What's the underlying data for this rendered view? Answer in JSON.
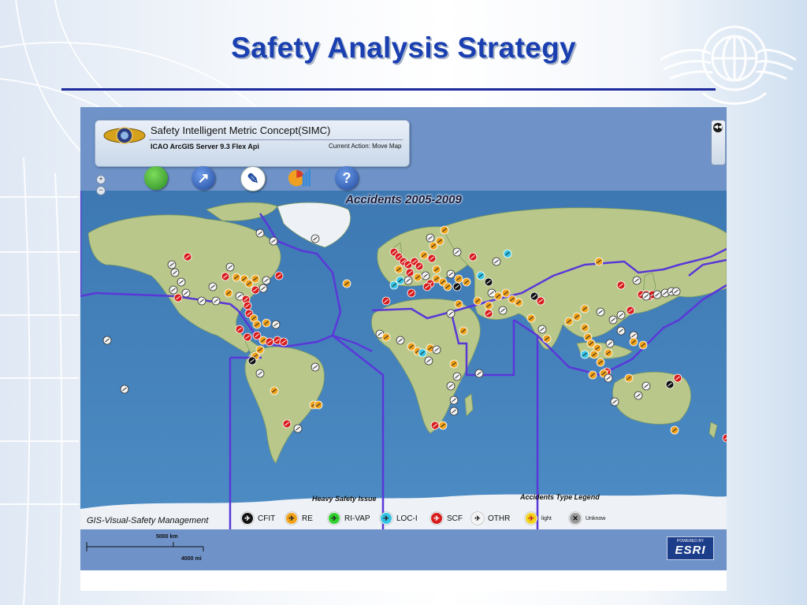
{
  "slide": {
    "title": "Safety Analysis Strategy"
  },
  "app": {
    "title": "Safety Intelligent Metric Concept(SIMC)",
    "subtitle": "ICAO ArcGIS Server 9.3 Flex Api",
    "current_action": "Current Action: Move Map",
    "zoom_in": "+",
    "zoom_out": "−"
  },
  "toolbar": {
    "tools": [
      {
        "icon": "globe-icon",
        "glyph": "",
        "color": "#3ea33a"
      },
      {
        "icon": "compass-icon",
        "glyph": "↗",
        "color": "#2c5cb8"
      },
      {
        "icon": "tools-icon",
        "glyph": "✎",
        "color": "#ffffff"
      },
      {
        "icon": "chart-icon",
        "glyph": "",
        "color": "#e8a020"
      },
      {
        "icon": "help-icon",
        "glyph": "?",
        "color": "#2c5cb8"
      }
    ]
  },
  "map": {
    "heading": "Accidents 2005-2009",
    "heavy_issue_label": "Heavy Safety Issue",
    "legend_title": "Accidents Type Legend",
    "footer_label": "GIS-Visual-Safety Management",
    "scale_km": "5000 km",
    "scale_mi": "4000 mi",
    "esri_powered": "POWERED BY",
    "esri_text": "ESRI"
  },
  "legend": [
    {
      "label": "CFIT",
      "color": "#111111",
      "glyph": "✈"
    },
    {
      "label": "RE",
      "color": "#f0a21a",
      "glyph": "✈"
    },
    {
      "label": "RI-VAP",
      "color": "#2fd02f",
      "glyph": "✈"
    },
    {
      "label": "LOC-I",
      "color": "#34c4e6",
      "glyph": "✈"
    },
    {
      "label": "SCF",
      "color": "#d81c1c",
      "glyph": "✈"
    },
    {
      "label": "OTHR",
      "color": "#f4f4f4",
      "glyph": "✈"
    },
    {
      "label": "light",
      "color": "#f2d21a",
      "glyph": "✈"
    },
    {
      "label": "Unknow",
      "color": "#9a9a9a",
      "glyph": "✕"
    }
  ],
  "colors": {
    "ocean": "#4b88c0",
    "land": "#b8c98a",
    "ice": "#f2f5f8",
    "region_border": "#5a38d8",
    "title": "#1a3fb0"
  }
}
